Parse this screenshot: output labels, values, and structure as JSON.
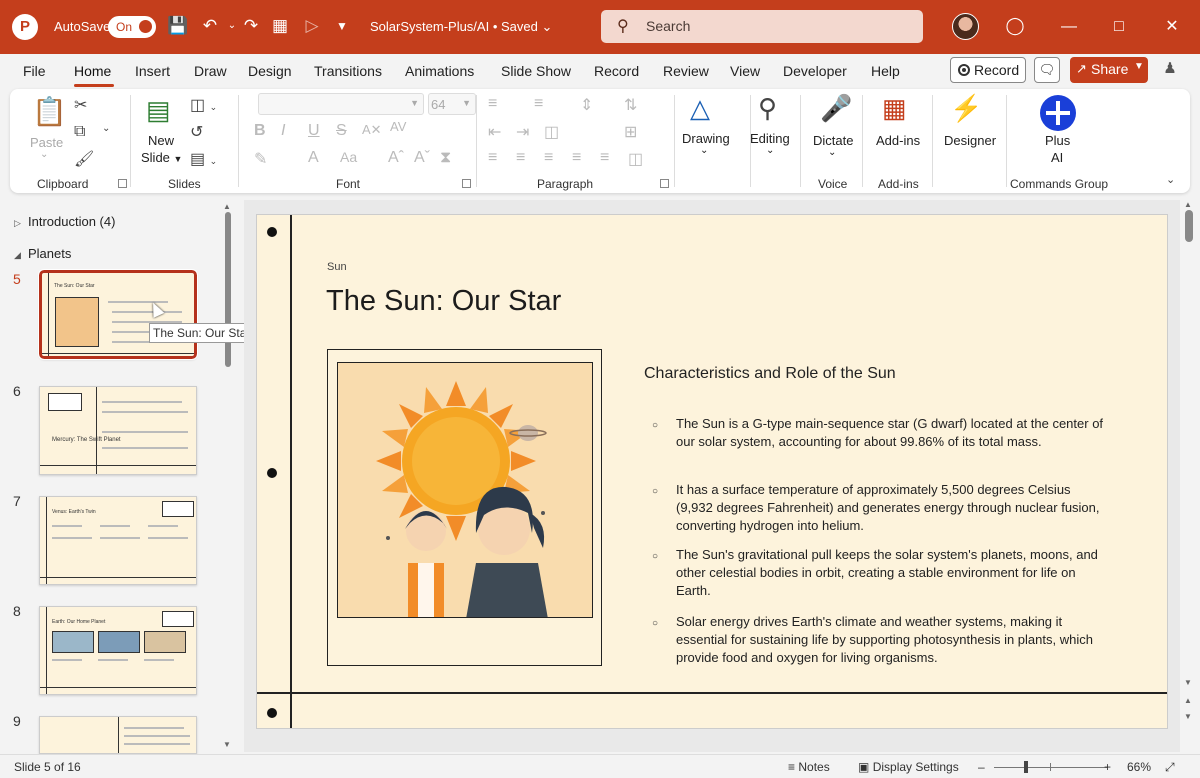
{
  "titlebar": {
    "app_letter": "P",
    "autosave_label": "AutoSave",
    "toggle_label": "On",
    "filename": "SolarSystem-Plus/AI",
    "saved_status": "Saved",
    "search_placeholder": "Search"
  },
  "menu": {
    "tabs": [
      "File",
      "Home",
      "Insert",
      "Draw",
      "Design",
      "Transitions",
      "Animations",
      "Slide Show",
      "Record",
      "Review",
      "View",
      "Developer",
      "Help"
    ],
    "active_tab": "Home",
    "record_label": "Record",
    "share_label": "Share"
  },
  "ribbon": {
    "groups": {
      "clipboard": "Clipboard",
      "slides": "Slides",
      "font": "Font",
      "paragraph": "Paragraph",
      "voice": "Voice",
      "addins": "Add-ins",
      "commands": "Commands Group"
    },
    "paste_label": "Paste",
    "new_slide_label": "New",
    "new_slide_label2": "Slide",
    "font_size_value": "64",
    "drawing_label": "Drawing",
    "editing_label": "Editing",
    "dictate_label": "Dictate",
    "addins_label": "Add-ins",
    "designer_label": "Designer",
    "plus_ai_label": "Plus",
    "plus_ai_label2": "AI"
  },
  "thumbnails": {
    "sections": [
      {
        "name": "Introduction (4)",
        "expanded": false
      },
      {
        "name": "Planets",
        "expanded": true
      }
    ],
    "slides": [
      {
        "number": "5",
        "title": "The Sun: Our Star",
        "selected": true
      },
      {
        "number": "6",
        "title": "Mercury: The Swift Planet",
        "selected": false
      },
      {
        "number": "7",
        "title": "Venus: Earth's Twin",
        "selected": false
      },
      {
        "number": "8",
        "title": "Earth: Our Home Planet",
        "selected": false
      },
      {
        "number": "9",
        "title": "",
        "selected": false
      }
    ],
    "tooltip": "The Sun: Our Star"
  },
  "slide": {
    "eyebrow": "Sun",
    "title": "The Sun: Our Star",
    "content_heading": "Characteristics and Role of the Sun",
    "bullets": [
      "The Sun is a G-type main-sequence star (G dwarf) located at the center of our solar system, accounting for about 99.86% of its total mass.",
      "It has a surface temperature of approximately 5,500 degrees Celsius (9,932 degrees Fahrenheit) and generates energy through nuclear fusion, converting hydrogen into helium.",
      "The Sun's gravitational pull keeps the solar system's planets, moons, and other celestial bodies in orbit, creating a stable environment for life on Earth.",
      "Solar energy drives Earth's climate and weather systems, making it essential for sustaining life by supporting photosynthesis in plants, which provide food and oxygen for living organisms."
    ]
  },
  "statusbar": {
    "slide_counter": "Slide 5 of 16",
    "notes_label": "Notes",
    "display_settings_label": "Display Settings",
    "zoom_value": "66%"
  },
  "colors": {
    "accent": "#c43e1c",
    "slide_bg": "#fdf3dc",
    "plus_ai_blue": "#1a3fd8"
  }
}
